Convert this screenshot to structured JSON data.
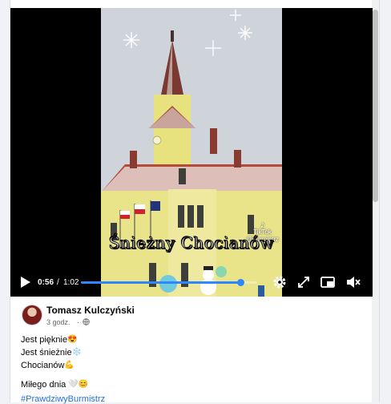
{
  "video": {
    "caption": "Śnieżny Chocianów",
    "watermark_brand": "TikTok",
    "watermark_handle": "@burmistrz",
    "time_current": "0:56",
    "time_separator": "/",
    "time_total": "1:02",
    "progress": 0.903,
    "progress_color": "#2d88ff"
  },
  "post": {
    "author": "Tomasz Kulczyński",
    "time": "3 godz.",
    "dot": "·",
    "lines": [
      {
        "text": "Jest pięknie",
        "emoji": "😍"
      },
      {
        "text": "Jest śnieżnie",
        "emoji": "❄️"
      },
      {
        "text": "Chocianów",
        "emoji": "💪"
      },
      {
        "text": "Miłego dnia",
        "emoji": "🤍😊"
      }
    ],
    "hashtag": "#PrawdziwyBurmistrz"
  },
  "icons": [
    "play-icon",
    "settings-icon",
    "fullscreen-icon",
    "picture-in-picture-icon",
    "mute-icon",
    "globe-icon"
  ]
}
